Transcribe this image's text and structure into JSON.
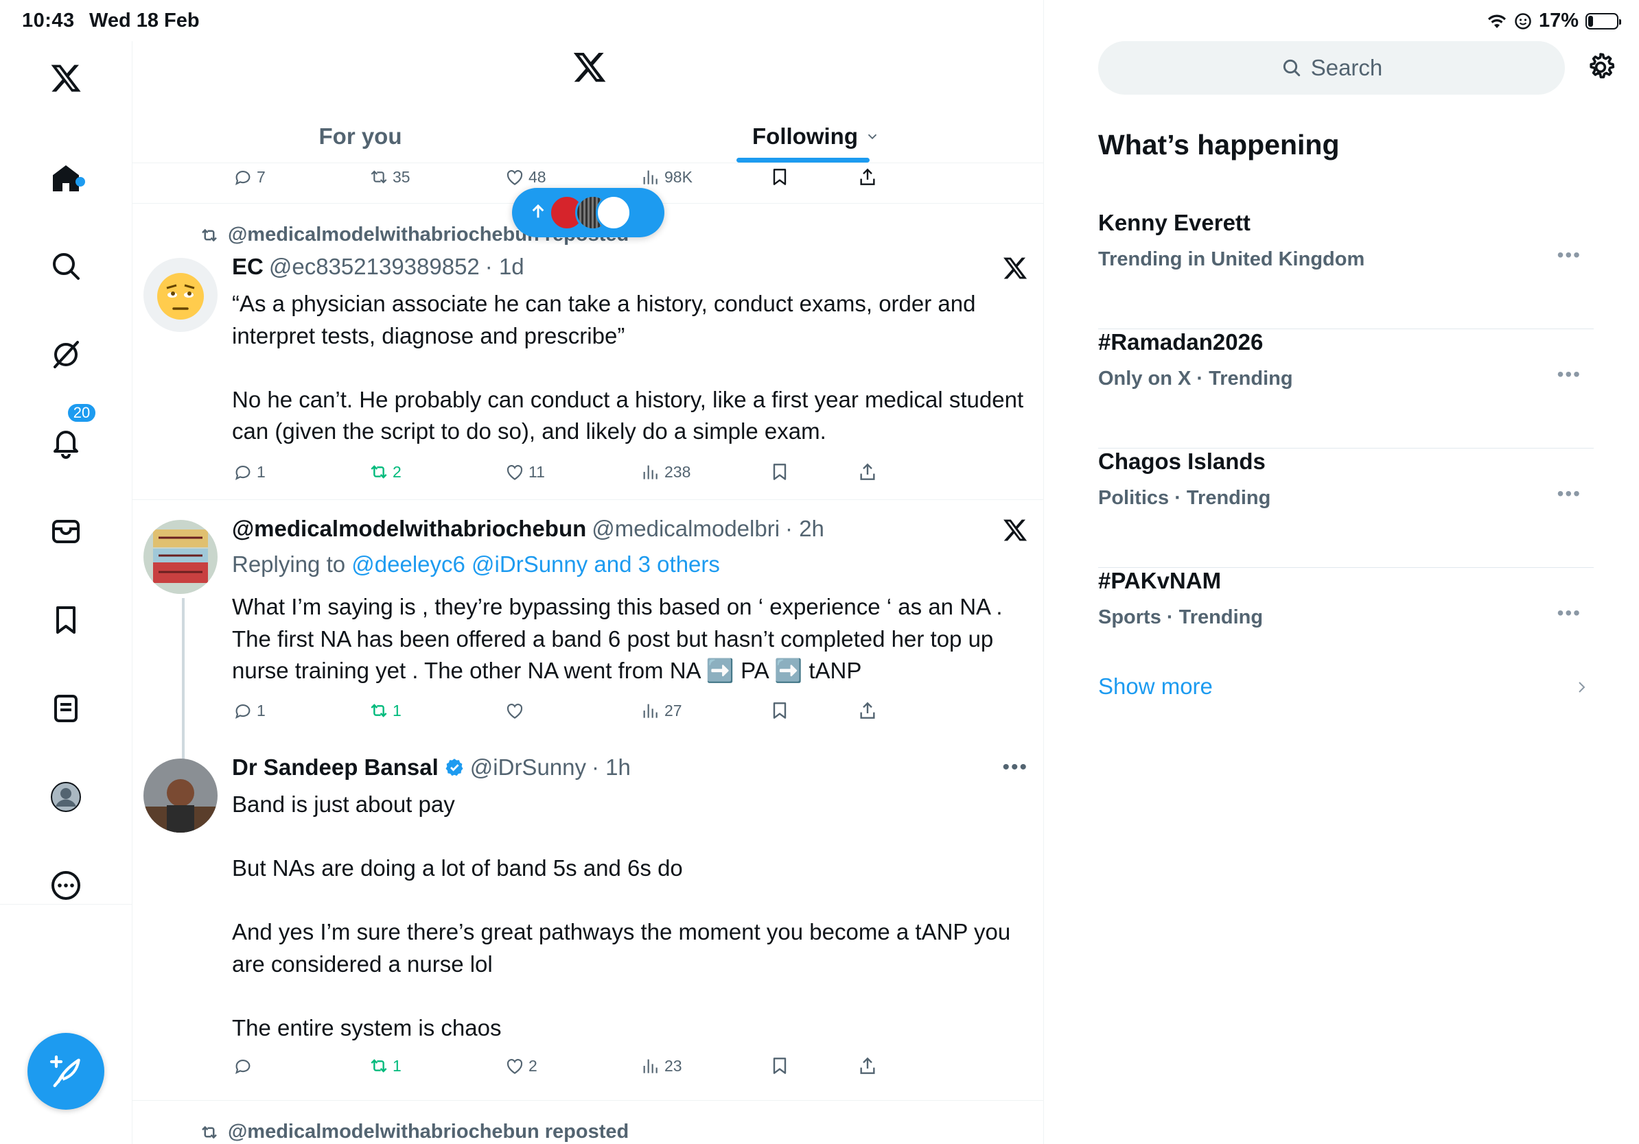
{
  "status": {
    "time": "10:43",
    "date": "Wed 18 Feb",
    "battery": "17%",
    "battery_level": 0.17
  },
  "nav": {
    "items": [
      "x-logo",
      "home",
      "search",
      "grok",
      "notifications",
      "messages",
      "bookmarks",
      "lists",
      "profile",
      "more"
    ],
    "notifications_badge": "20"
  },
  "header": {
    "tab_foryou": "For you",
    "tab_following": "Following"
  },
  "top_actions": {
    "replies": "7",
    "reposts": "35",
    "likes": "48",
    "views": "98K"
  },
  "tweet1": {
    "repost_label": "@medicalmodelwithabriochebun reposted",
    "name": "EC",
    "handle": "@ec8352139389852",
    "time": "· 1d",
    "text": "“As a physician associate he can take a history, conduct exams, order and interpret tests, diagnose and prescribe”\n\nNo he can’t. He probably can conduct a history, like a first year medical student can (given the script to do so), and likely do a simple exam.",
    "replies": "1",
    "reposts": "2",
    "likes": "11",
    "views": "238"
  },
  "tweet2": {
    "name": "@medicalmodelwithabriochebun",
    "handle": "@medicalmodelbri",
    "time": "· 2h",
    "reply_prefix": "Replying to",
    "reply_targets": "@deeleyc6 @iDrSunny and 3 others",
    "text": "What I’m saying is , they’re bypassing this based on ‘ experience ‘ as an NA . The first NA has been offered a band 6 post but hasn’t completed her top up nurse training yet . The other NA went from NA ➡️ PA ➡️ tANP",
    "replies": "1",
    "reposts": "1",
    "likes": "",
    "views": "27"
  },
  "tweet3": {
    "name": "Dr Sandeep Bansal",
    "handle": "@iDrSunny",
    "time": "· 1h",
    "text": "Band is just about pay\n\nBut NAs are doing a lot of band 5s and 6s do\n\nAnd yes I’m sure there’s great pathways the moment you become a tANP you are considered a nurse lol\n\nThe entire system is chaos",
    "replies": "",
    "reposts": "1",
    "likes": "2",
    "views": "23"
  },
  "tweet4": {
    "repost_label": "@medicalmodelwithabriochebun reposted"
  },
  "right": {
    "search_placeholder": "Search",
    "title": "What’s happening",
    "trends": [
      {
        "name": "Kenny Everett",
        "meta": "Trending in United Kingdom"
      },
      {
        "name": "#Ramadan2026",
        "meta": "Only on X · Trending"
      },
      {
        "name": "Chagos Islands",
        "meta": "Politics · Trending"
      },
      {
        "name": "#PAKvNAM",
        "meta": "Sports · Trending"
      }
    ],
    "show_more": "Show more"
  },
  "colors": {
    "accent": "#1d9bf0",
    "repost_green": "#00ba7c",
    "muted": "#536471"
  }
}
